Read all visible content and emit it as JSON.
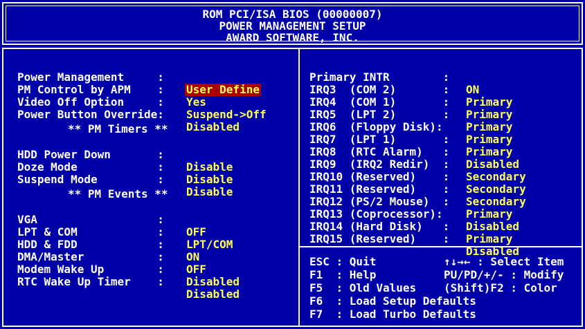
{
  "header": {
    "line1": "ROM PCI/ISA BIOS (00000007)",
    "line2": "POWER MANAGEMENT SETUP",
    "line3": "AWARD SOFTWARE, INC."
  },
  "left": {
    "power_management": {
      "label": "Power Management     :",
      "value": "User Define"
    },
    "pm_control": {
      "label": "PM Control by APM    :",
      "value": "Yes"
    },
    "video_off": {
      "label": "Video Off Option     :",
      "value": "Suspend->Off"
    },
    "power_button": {
      "label": "Power Button Override:",
      "value": "Disabled"
    },
    "pm_timers_heading": "** PM Timers **",
    "hdd_power_down": {
      "label": "HDD Power Down       :",
      "value": "Disable"
    },
    "doze_mode": {
      "label": "Doze Mode            :",
      "value": "Disable"
    },
    "suspend_mode": {
      "label": "Suspend Mode         :",
      "value": "Disable"
    },
    "pm_events_heading": "** PM Events **",
    "vga": {
      "label": "VGA                  :",
      "value": "OFF"
    },
    "lpt_com": {
      "label": "LPT & COM            :",
      "value": "LPT/COM"
    },
    "hdd_fdd": {
      "label": "HDD & FDD            :",
      "value": "ON"
    },
    "dma_master": {
      "label": "DMA/Master           :",
      "value": "OFF"
    },
    "modem_wake": {
      "label": "Modem Wake Up        :",
      "value": "Disabled"
    },
    "rtc_wake": {
      "label": "RTC Wake Up Timer    :",
      "value": "Disabled"
    }
  },
  "right": {
    "items": [
      {
        "label": "Primary INTR        :",
        "value": "ON"
      },
      {
        "label": "IRQ3  (COM 2)       :",
        "value": "Primary"
      },
      {
        "label": "IRQ4  (COM 1)       :",
        "value": "Primary"
      },
      {
        "label": "IRQ5  (LPT 2)       :",
        "value": "Primary"
      },
      {
        "label": "IRQ6  (Floppy Disk):",
        "value": "Primary"
      },
      {
        "label": "IRQ7  (LPT 1)       :",
        "value": "Primary"
      },
      {
        "label": "IRQ8  (RTC Alarm)   :",
        "value": "Disabled"
      },
      {
        "label": "IRQ9  (IRQ2 Redir)  :",
        "value": "Secondary"
      },
      {
        "label": "IRQ10 (Reserved)    :",
        "value": "Secondary"
      },
      {
        "label": "IRQ11 (Reserved)    :",
        "value": "Secondary"
      },
      {
        "label": "IRQ12 (PS/2 Mouse)  :",
        "value": "Primary"
      },
      {
        "label": "IRQ13 (Coprocessor):",
        "value": "Disabled"
      },
      {
        "label": "IRQ14 (Hard Disk)   :",
        "value": "Primary"
      },
      {
        "label": "IRQ15 (Reserved)    :",
        "value": "Disabled"
      }
    ]
  },
  "help": {
    "esc": "ESC : Quit",
    "select": "↑↓→← : Select Item",
    "f1": "F1  : Help",
    "modify": "PU/PD/+/- : Modify",
    "f5": "F5  : Old Values",
    "color": "(Shift)F2 : Color",
    "f6": "F6  : Load Setup Defaults",
    "f7": "F7  : Load Turbo Defaults"
  },
  "colors": {
    "background": "#0000a8",
    "value": "#ffff54",
    "highlight": "#a80000",
    "text": "#ffffff"
  }
}
